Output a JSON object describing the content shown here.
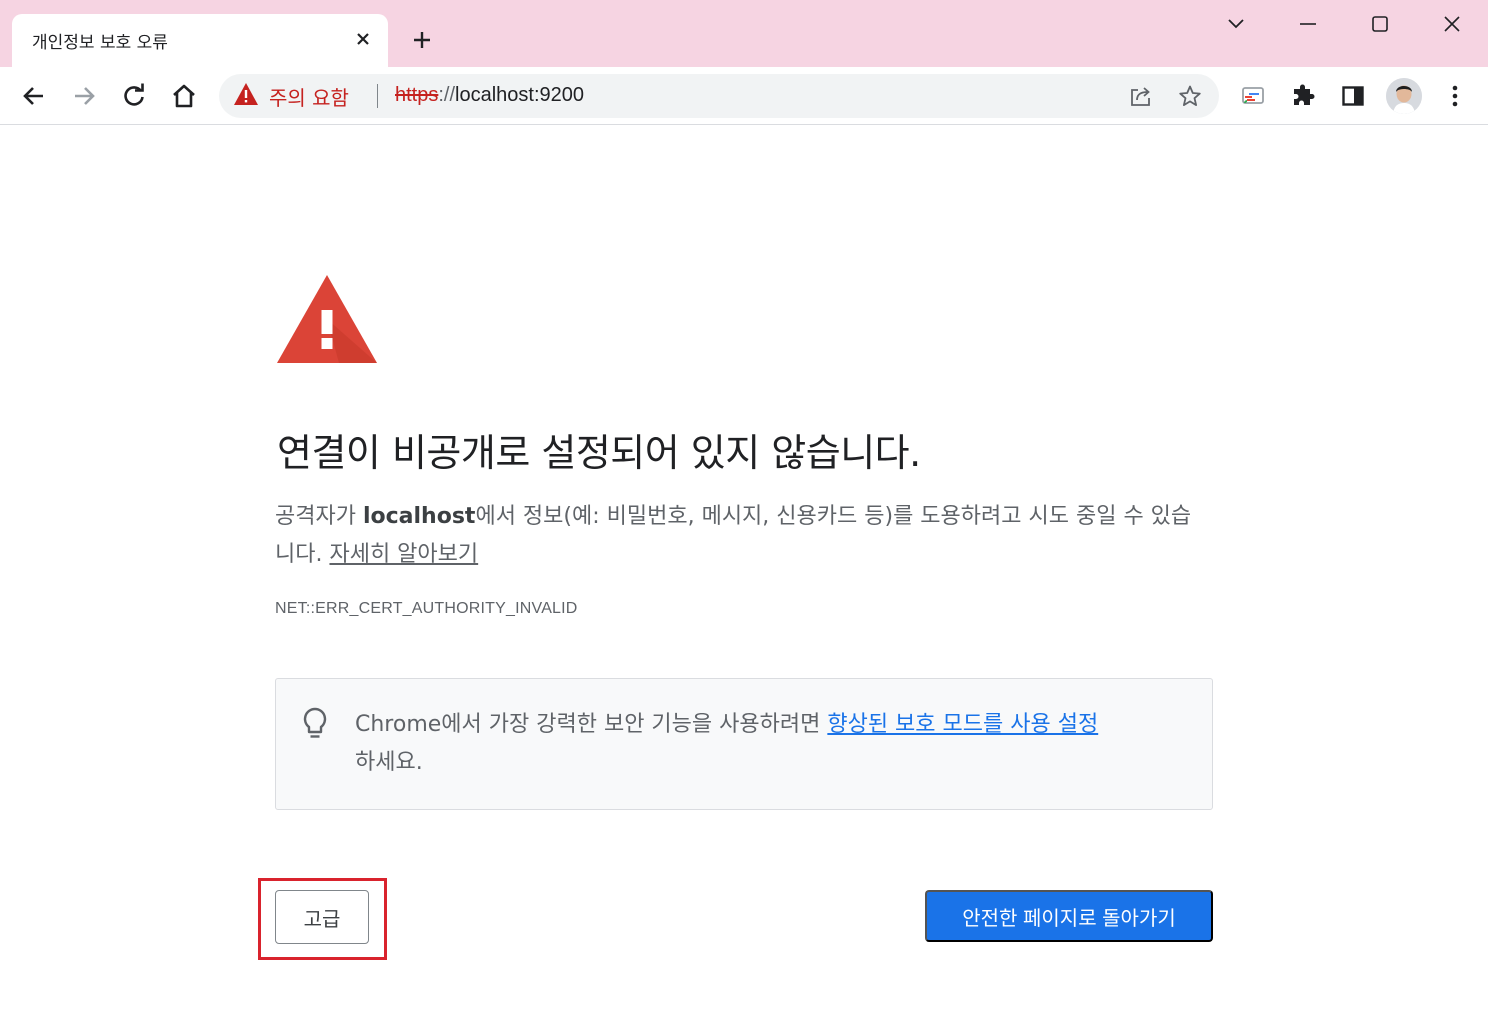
{
  "tab": {
    "title": "개인정보 보호 오류",
    "close_icon": "close-icon",
    "new_tab_icon": "plus-icon"
  },
  "window_controls": [
    "tab-search-icon",
    "minimize-icon",
    "maximize-icon",
    "close-icon"
  ],
  "toolbar": {
    "back_icon": "back-arrow-icon",
    "forward_icon": "forward-arrow-icon",
    "reload_icon": "reload-icon",
    "home_icon": "home-icon",
    "security_warning": "주의 요함",
    "url_scheme": "https",
    "url_separator": "://",
    "url_host": "localhost:9200",
    "share_icon": "share-icon",
    "bookmark_icon": "star-icon",
    "cast_icon": "cast-icon",
    "extensions_icon": "puzzle-icon",
    "side_panel_icon": "side-panel-icon",
    "profile_icon": "avatar",
    "menu_icon": "more-vert-icon"
  },
  "page": {
    "heading": "연결이 비공개로 설정되어 있지 않습니다.",
    "desc_prefix": "공격자가 ",
    "desc_host": "localhost",
    "desc_suffix": "에서 정보(예: 비밀번호, 메시지, 신용카드 등)를 도용하려고 시도 중일 수 있습니다. ",
    "learn_more": "자세히 알아보기",
    "error_code": "NET::ERR_CERT_AUTHORITY_INVALID",
    "info_prefix": "Chrome에서 가장 강력한 보안 기능을 사용하려면 ",
    "info_link": "향상된 보호 모드를 사용 설정",
    "info_suffix": "하세요.",
    "advanced_button": "고급",
    "back_to_safety_button": "안전한 페이지로 돌아가기"
  },
  "colors": {
    "tab_strip": "#f6d4e2",
    "warning_red": "#d93025",
    "primary_blue": "#1a73e8",
    "highlight_red": "#d9232d"
  }
}
